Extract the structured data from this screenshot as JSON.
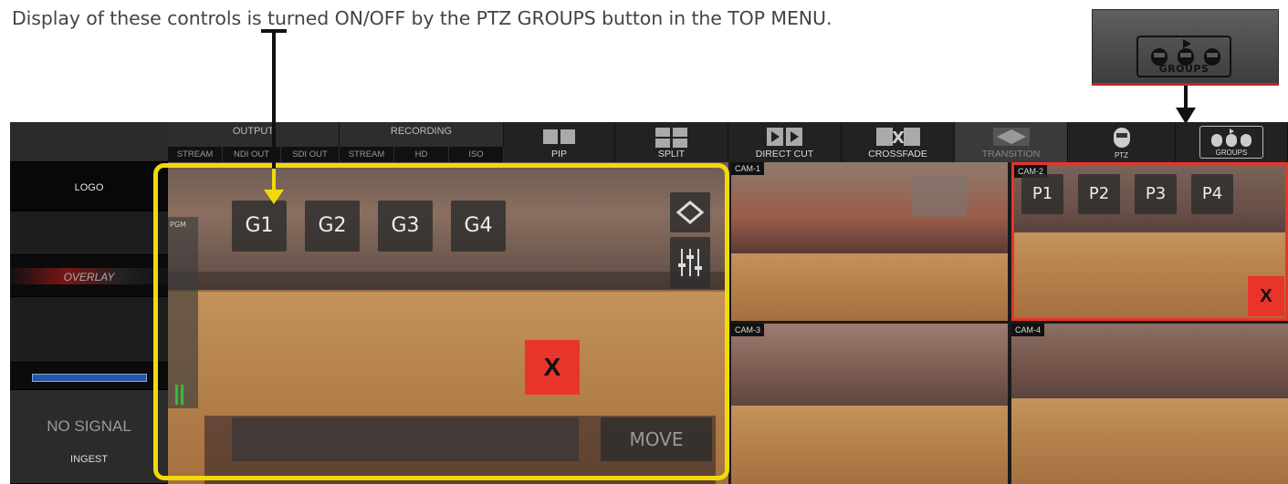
{
  "caption": "Display of these controls is turned ON/OFF by the PTZ GROUPS button in the TOP MENU.",
  "callout": {
    "groups_label": "GROUPS"
  },
  "sidebar": {
    "logo_label": "LOGO",
    "overlay_label": "OVERLAY",
    "no_signal": "NO SIGNAL",
    "ingest": "INGEST"
  },
  "topbar": {
    "output": {
      "title": "OUTPUT",
      "items": [
        "STREAM",
        "NDI OUT",
        "SDI OUT"
      ]
    },
    "recording": {
      "title": "RECORDING",
      "items": [
        "STREAM",
        "HD",
        "ISO"
      ]
    },
    "pip": "PIP",
    "split": "SPLIT",
    "direct_cut": "DIRECT CUT",
    "crossfade": "CROSSFADE",
    "transition": "TRANSITION",
    "ptz": "PTZ",
    "groups": "GROUPS"
  },
  "program": {
    "pgm_label": "PGM",
    "groups": [
      "G1",
      "G2",
      "G3",
      "G4"
    ],
    "x_label": "X",
    "move_label": "MOVE"
  },
  "cams": [
    {
      "label": "CAM-1"
    },
    {
      "label": "CAM-2"
    },
    {
      "label": "CAM-3"
    },
    {
      "label": "CAM-4"
    }
  ],
  "presets": [
    "P1",
    "P2",
    "P3",
    "P4"
  ],
  "preset_x": "X",
  "colors": {
    "highlight_yellow": "#f2d90a",
    "active_red": "#e8342b",
    "topbar": "#2d2d2d"
  }
}
